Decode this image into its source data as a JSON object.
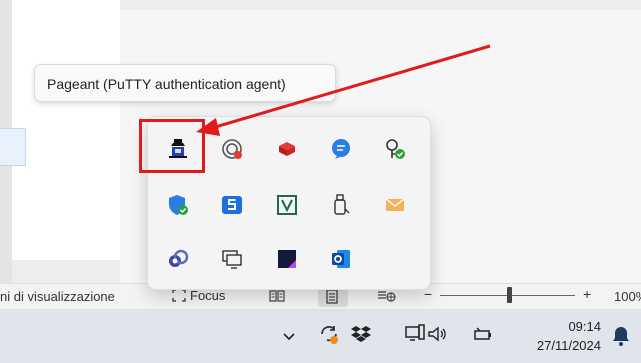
{
  "tooltip": {
    "text": "Pageant (PuTTY authentication agent)"
  },
  "tray_flyout": {
    "icons": [
      {
        "name": "pageant-icon"
      },
      {
        "name": "broadcast-icon"
      },
      {
        "name": "red-cube-icon"
      },
      {
        "name": "chat-bubble-icon"
      },
      {
        "name": "key-check-icon"
      },
      {
        "name": "security-shield-icon"
      },
      {
        "name": "html5-icon"
      },
      {
        "name": "visio-icon"
      },
      {
        "name": "usb-drive-icon"
      },
      {
        "name": "mail-envelope-icon"
      },
      {
        "name": "link-icon"
      },
      {
        "name": "remote-desktop-icon"
      },
      {
        "name": "dark-app-icon"
      },
      {
        "name": "outlook-icon"
      }
    ]
  },
  "statusbar": {
    "view_text": "ni di visualizzazione",
    "focus_label": "Focus",
    "zoom_minus": "−",
    "zoom_plus": "+",
    "zoom_percent": "100%",
    "zoom_level": 0.5
  },
  "taskbar": {
    "chevron": "∨",
    "time": "09:14",
    "date": "27/11/2024"
  },
  "colors": {
    "highlight_red": "#e11b1b",
    "accent_blue": "#1a73e8"
  }
}
